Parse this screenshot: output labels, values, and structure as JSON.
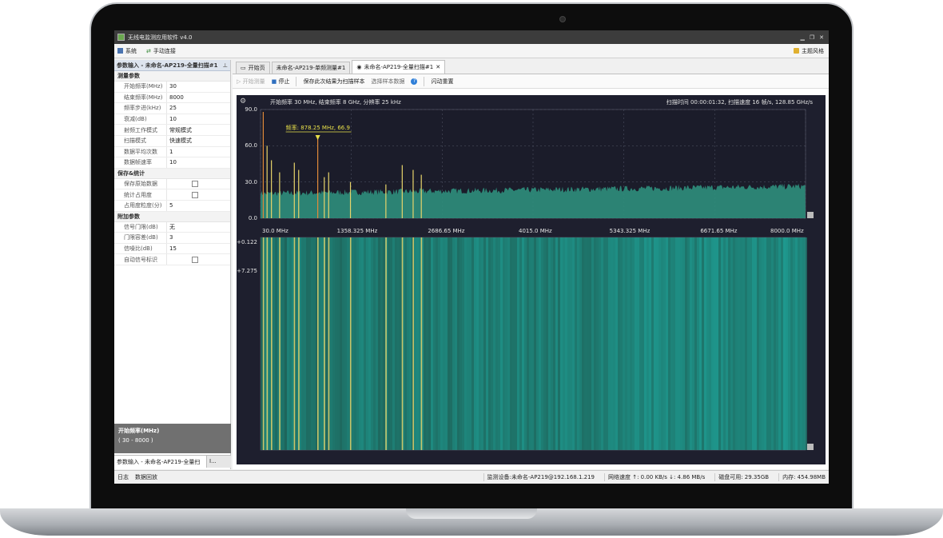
{
  "window": {
    "title": "无线电监测应用软件 v4.0"
  },
  "menu": {
    "system": "系统",
    "manual_connect": "手动连接",
    "theme": "主题风格"
  },
  "left_panel": {
    "header": "参数输入 - 未命名-AP219-全量扫描#1",
    "sections": [
      {
        "title": "测量参数",
        "rows": [
          {
            "k": "开始频率(MHz)",
            "v": "30"
          },
          {
            "k": "结束频率(MHz)",
            "v": "8000"
          },
          {
            "k": "频率步进(kHz)",
            "v": "25"
          },
          {
            "k": "衰减(dB)",
            "v": "10"
          },
          {
            "k": "射频工作模式",
            "v": "常规模式"
          },
          {
            "k": "扫描模式",
            "v": "快速模式"
          },
          {
            "k": "数据平均次数",
            "v": "1"
          },
          {
            "k": "数据帧速率",
            "v": "10"
          }
        ]
      },
      {
        "title": "保存&统计",
        "rows": [
          {
            "k": "保存原始数据",
            "v": ""
          },
          {
            "k": "统计占用度",
            "v": ""
          },
          {
            "k": "占用度粒度(分)",
            "v": "5"
          }
        ]
      },
      {
        "title": "附加参数",
        "rows": [
          {
            "k": "信号门限(dB)",
            "v": "无"
          },
          {
            "k": "门限容差(dB)",
            "v": "3"
          },
          {
            "k": "信噪比(dB)",
            "v": "15"
          },
          {
            "k": "自动信号标识",
            "v": ""
          }
        ]
      }
    ],
    "desc_title": "开始频率(MHz)",
    "desc_range": "( 30 - 8000 )",
    "bottom_tab_1": "参数输入 - 未命名-AP219-全量扫",
    "bottom_tab_2": "I..."
  },
  "tabs": [
    "开始页",
    "未命名-AP219-单频测量#1",
    "未命名-AP219-全量扫描#1"
  ],
  "toolbar": {
    "start": "开始测量",
    "stop": "停止",
    "save_result": "保存此次结果为扫描样本",
    "select_sample": "选择样本数据",
    "flash_reset": "闪动重置"
  },
  "spectrum": {
    "left_info": "开始频率 30 MHz, 结束频率 8 GHz, 分辨率 25 kHz",
    "right_info": "扫描时间 00:00:01:32, 扫描速度 16 帧/s, 128.85 GHz/s",
    "marker": "频率: 878.25 MHz, 66.9",
    "y_ticks": [
      "90.0",
      "60.0",
      "30.0",
      "0.0"
    ],
    "x_ticks": [
      "30.0 MHz",
      "1358.325 MHz",
      "2686.65 MHz",
      "4015.0 MHz",
      "5343.325 MHz",
      "6671.65 MHz",
      "8000.0 MHz"
    ],
    "wf_ticks": [
      "+0.122",
      "+7.275"
    ]
  },
  "status": {
    "left1": "日志",
    "left2": "数据回放",
    "device": "监测设备:未命名-AP219@192.168.1.219",
    "net": "网络速度 ↑: 0.00 KB/s ↓: 4.86 MB/s",
    "disk": "磁盘可用: 29.35GB",
    "mem": "内存: 454.98MB"
  },
  "colors": {
    "plot_bg": "#1e1f2e",
    "noise": "#2f8f7c",
    "waterfall": "#1f6f72",
    "signal": "#e8d46a",
    "marker": "#e8e04a"
  }
}
